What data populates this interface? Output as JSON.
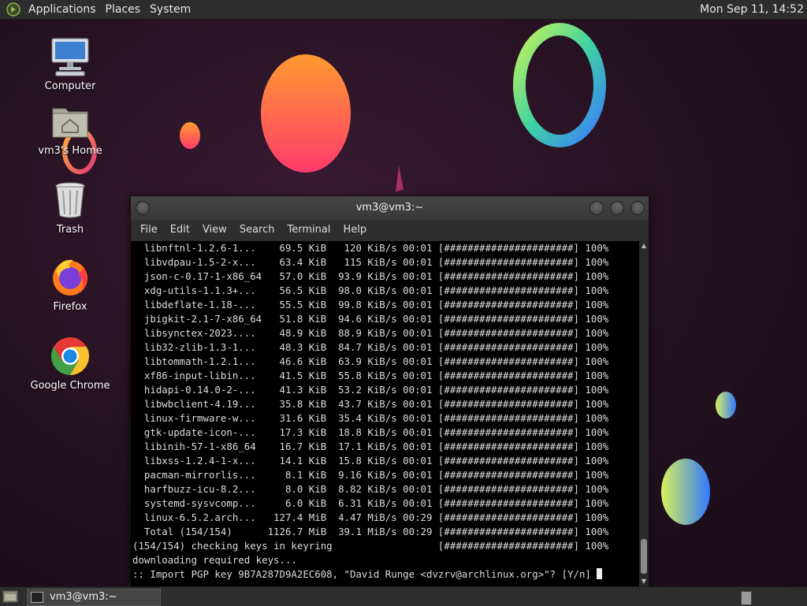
{
  "top_panel": {
    "menus": [
      "Applications",
      "Places",
      "System"
    ],
    "clock": "Mon Sep 11, 14:52"
  },
  "desktop_icons": [
    {
      "label": "Computer",
      "icon": "computer-icon"
    },
    {
      "label": "vm3's Home",
      "icon": "home-folder-icon"
    },
    {
      "label": "Trash",
      "icon": "trash-icon"
    },
    {
      "label": "Firefox",
      "icon": "firefox-icon"
    },
    {
      "label": "Google Chrome",
      "icon": "chrome-icon"
    }
  ],
  "terminal": {
    "title": "vm3@vm3:~",
    "menu": [
      "File",
      "Edit",
      "View",
      "Search",
      "Terminal",
      "Help"
    ],
    "lines": [
      "  libnftnl-1.2.6-1...    69.5 KiB   120 KiB/s 00:01 [######################] 100%",
      "  libvdpau-1.5-2-x...    63.4 KiB   115 KiB/s 00:01 [######################] 100%",
      "  json-c-0.17-1-x86_64   57.0 KiB  93.9 KiB/s 00:01 [######################] 100%",
      "  xdg-utils-1.1.3+...    56.5 KiB  98.0 KiB/s 00:01 [######################] 100%",
      "  libdeflate-1.18-...    55.5 KiB  99.8 KiB/s 00:01 [######################] 100%",
      "  jbigkit-2.1-7-x86_64   51.8 KiB  94.6 KiB/s 00:01 [######################] 100%",
      "  libsynctex-2023....    48.9 KiB  88.9 KiB/s 00:01 [######################] 100%",
      "  lib32-zlib-1.3-1...    48.3 KiB  84.7 KiB/s 00:01 [######################] 100%",
      "  libtommath-1.2.1...    46.6 KiB  63.9 KiB/s 00:01 [######################] 100%",
      "  xf86-input-libin...    41.5 KiB  55.8 KiB/s 00:01 [######################] 100%",
      "  hidapi-0.14.0-2-...    41.3 KiB  53.2 KiB/s 00:01 [######################] 100%",
      "  libwbclient-4.19...    35.8 KiB  43.7 KiB/s 00:01 [######################] 100%",
      "  linux-firmware-w...    31.6 KiB  35.4 KiB/s 00:01 [######################] 100%",
      "  gtk-update-icon-...    17.3 KiB  18.8 KiB/s 00:01 [######################] 100%",
      "  libinih-57-1-x86_64    16.7 KiB  17.1 KiB/s 00:01 [######################] 100%",
      "  libxss-1.2.4-1-x...    14.1 KiB  15.8 KiB/s 00:01 [######################] 100%",
      "  pacman-mirrorlis...     8.1 KiB  9.16 KiB/s 00:01 [######################] 100%",
      "  harfbuzz-icu-8.2...     8.0 KiB  8.82 KiB/s 00:01 [######################] 100%",
      "  systemd-sysvcomp...     6.0 KiB  6.31 KiB/s 00:01 [######################] 100%",
      "  linux-6.5.2.arch...   127.4 MiB  4.47 MiB/s 00:29 [######################] 100%",
      "  Total (154/154)      1126.7 MiB  39.1 MiB/s 00:29 [######################] 100%",
      "(154/154) checking keys in keyring                  [######################] 100%",
      "downloading required keys...",
      ":: Import PGP key 9B7A287D9A2EC608, \"David Runge <dvzrv@archlinux.org>\"? [Y/n] "
    ]
  },
  "taskbar": {
    "items": [
      {
        "label": "vm3@vm3:~"
      }
    ]
  }
}
